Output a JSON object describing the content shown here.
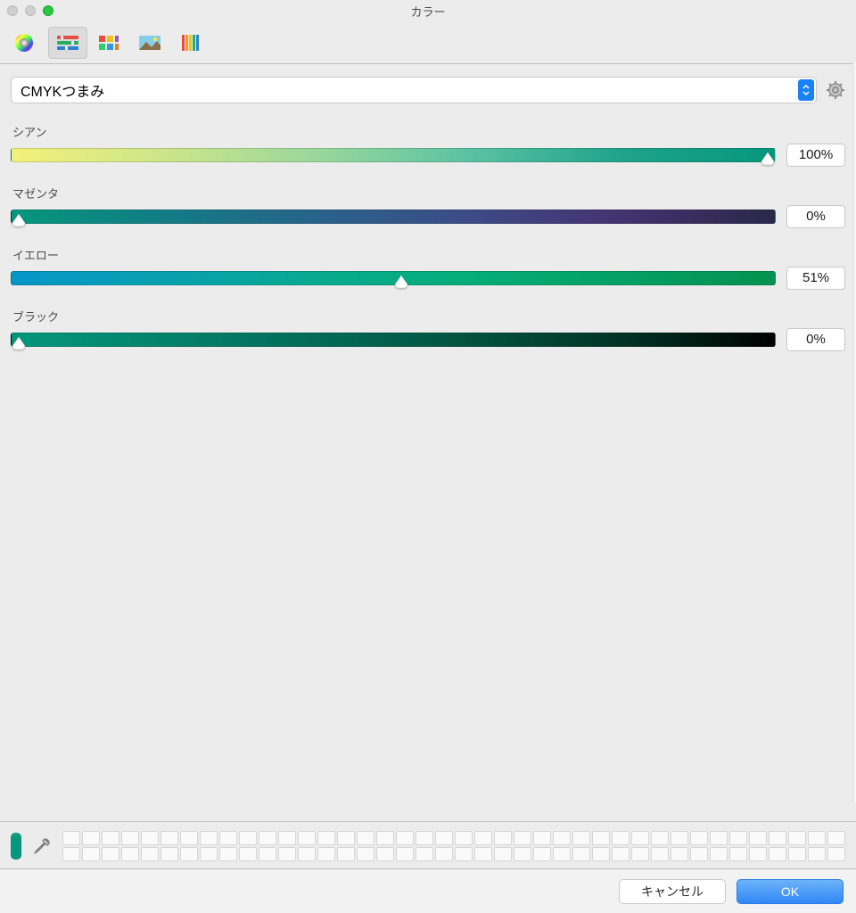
{
  "window": {
    "title": "カラー"
  },
  "toolbar": {
    "tabs": [
      "color-wheel",
      "sliders",
      "palette",
      "image",
      "pencils"
    ],
    "selected": "sliders"
  },
  "mode": {
    "selected_label": "CMYKつまみ"
  },
  "sliders": {
    "cyan": {
      "label": "シアン",
      "value_text": "100%",
      "percent": 100
    },
    "magenta": {
      "label": "マゼンタ",
      "value_text": "0%",
      "percent": 0
    },
    "yellow": {
      "label": "イエロー",
      "value_text": "51%",
      "percent": 51
    },
    "black": {
      "label": "ブラック",
      "value_text": "0%",
      "percent": 0
    }
  },
  "current_color": "#04977c",
  "footer": {
    "cancel": "キャンセル",
    "ok": "OK"
  },
  "swatch_count": 80
}
